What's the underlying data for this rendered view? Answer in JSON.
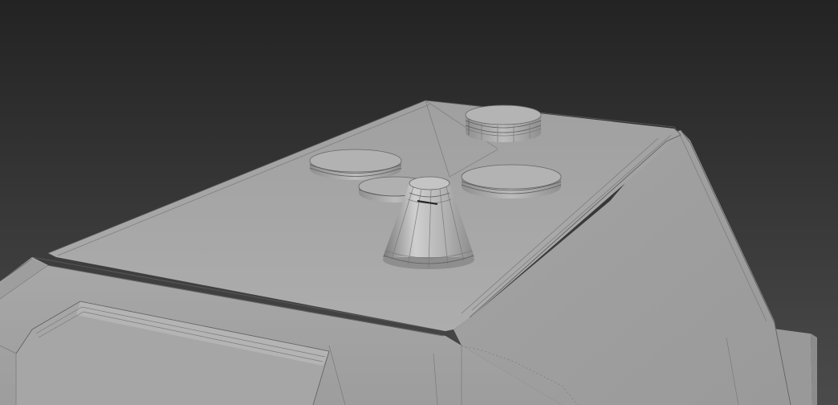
{
  "viewport": {
    "background_top": "#232323",
    "background_bottom": "#4a4a4a"
  },
  "model": {
    "surface_color": "#a9a9a9",
    "top_face_color": "#a5a5a5",
    "side_face_color": "#9a9a9a",
    "wire_color": "#5d5d5d"
  }
}
